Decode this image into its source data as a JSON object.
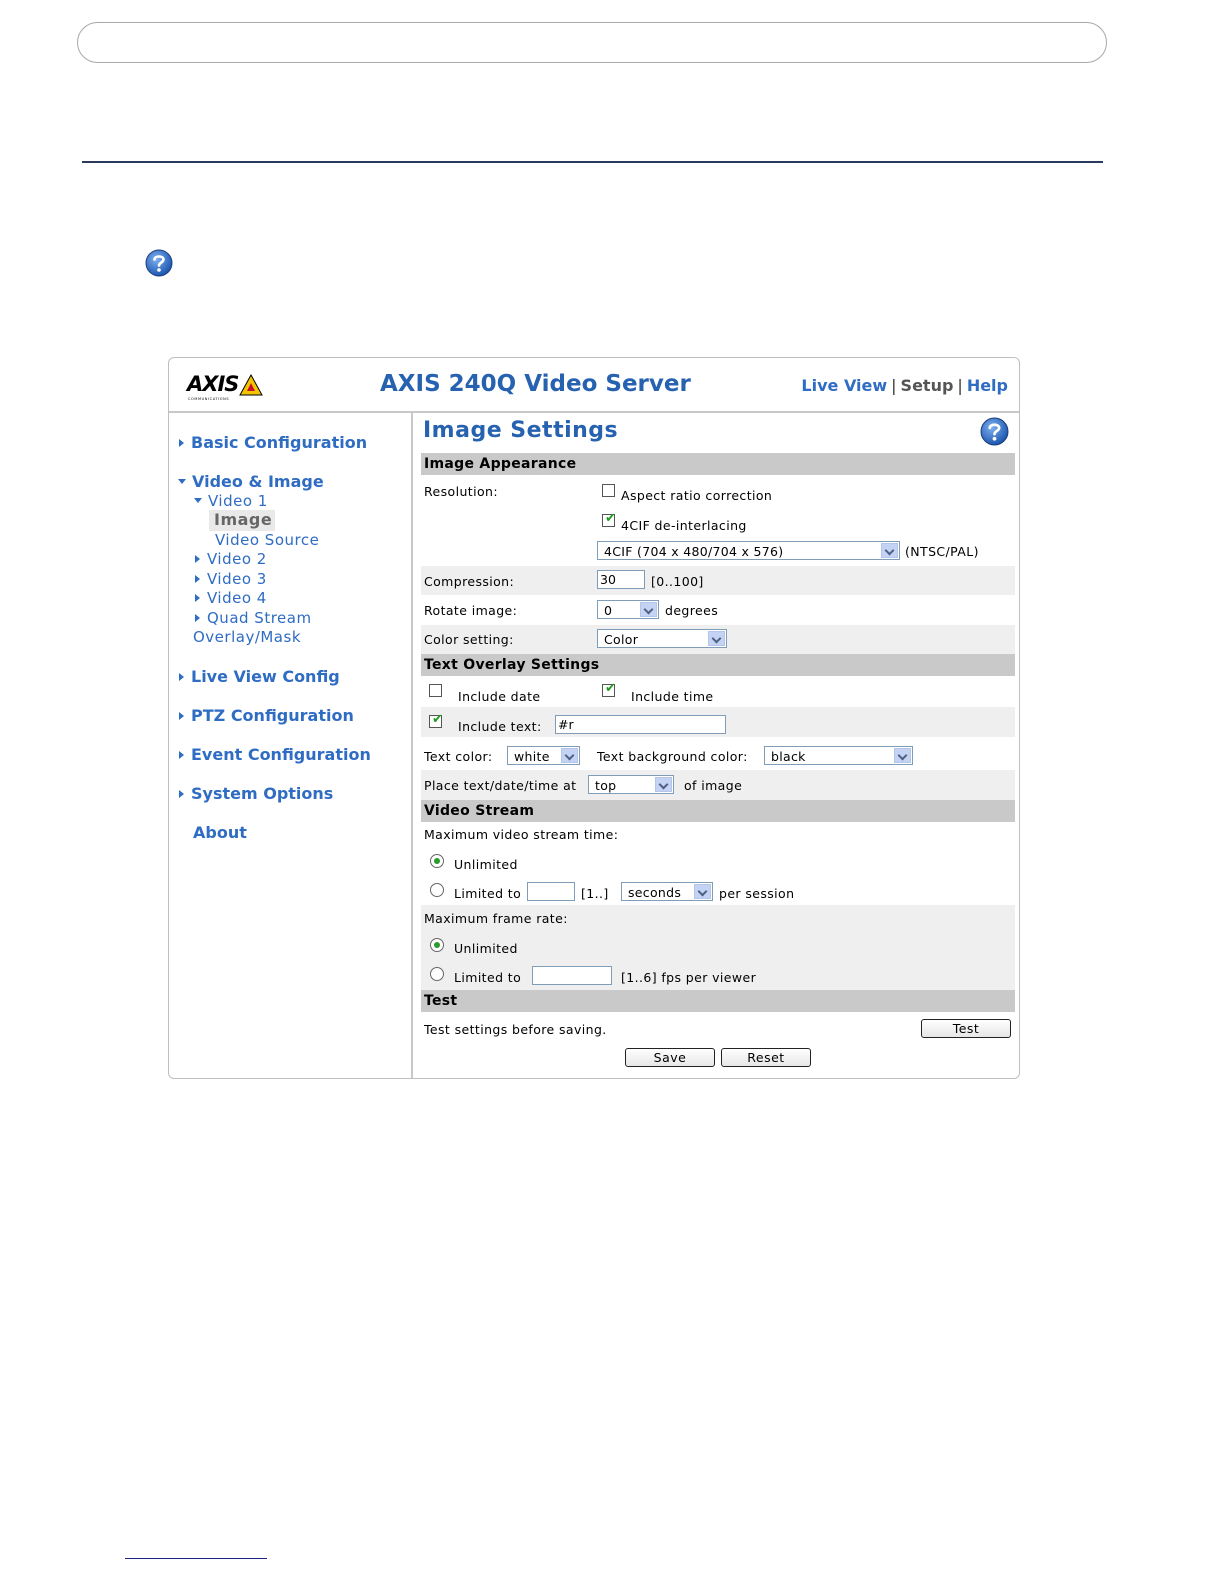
{
  "app": {
    "logo_text": "AXIS",
    "logo_sub": "COMMUNICATIONS",
    "title": "AXIS 240Q Video Server",
    "top_nav": {
      "live_view": "Live View",
      "setup": "Setup",
      "help": "Help",
      "separator": "|"
    }
  },
  "sidebar": {
    "basic_configuration": "Basic Configuration",
    "video_image": "Video & Image",
    "video1": "Video 1",
    "image": "Image",
    "video_source": "Video Source",
    "video2": "Video 2",
    "video3": "Video 3",
    "video4": "Video 4",
    "quad_stream": "Quad Stream",
    "overlay_mask": "Overlay/Mask",
    "live_view_config": "Live View Config",
    "ptz_configuration": "PTZ Configuration",
    "event_configuration": "Event Configuration",
    "system_options": "System Options",
    "about": "About"
  },
  "content": {
    "title": "Image Settings",
    "image_appearance": {
      "header": "Image Appearance",
      "resolution_label": "Resolution:",
      "aspect_ratio_label": "Aspect ratio correction",
      "aspect_ratio_checked": false,
      "deinterlacing_label": "4CIF de-interlacing",
      "deinterlacing_checked": true,
      "resolution_value": "4CIF (704 x 480/704 x 576)",
      "resolution_suffix": "(NTSC/PAL)",
      "compression_label": "Compression:",
      "compression_value": "30",
      "compression_range": "[0..100]",
      "rotate_label": "Rotate image:",
      "rotate_value": "0",
      "rotate_suffix": "degrees",
      "color_label": "Color setting:",
      "color_value": "Color"
    },
    "text_overlay": {
      "header": "Text Overlay Settings",
      "include_date_label": "Include date",
      "include_date_checked": false,
      "include_time_label": "Include time",
      "include_time_checked": true,
      "include_text_label": "Include text:",
      "include_text_checked": true,
      "include_text_value": "#r",
      "text_color_label": "Text color:",
      "text_color_value": "white",
      "bg_color_label": "Text background color:",
      "bg_color_value": "black",
      "place_label": "Place text/date/time at",
      "place_value": "top",
      "place_suffix": "of image"
    },
    "video_stream": {
      "header": "Video Stream",
      "max_time_label": "Maximum video stream time:",
      "time_unlimited_label": "Unlimited",
      "time_limited_label": "Limited to",
      "time_limited_value": "",
      "time_range": "[1..]",
      "time_unit_value": "seconds",
      "time_suffix": "per session",
      "time_selected": "unlimited",
      "max_fps_label": "Maximum frame rate:",
      "fps_unlimited_label": "Unlimited",
      "fps_limited_label": "Limited to",
      "fps_limited_value": "",
      "fps_range": "[1..6] fps per viewer",
      "fps_selected": "unlimited"
    },
    "test": {
      "header": "Test",
      "description": "Test settings before saving.",
      "test_button": "Test"
    },
    "save_button": "Save",
    "reset_button": "Reset"
  },
  "colors": {
    "accent": "#2762b0",
    "link": "#2f6cc3",
    "section": "#c9c9c9",
    "band": "#efefef",
    "check": "#1f9a1f"
  }
}
